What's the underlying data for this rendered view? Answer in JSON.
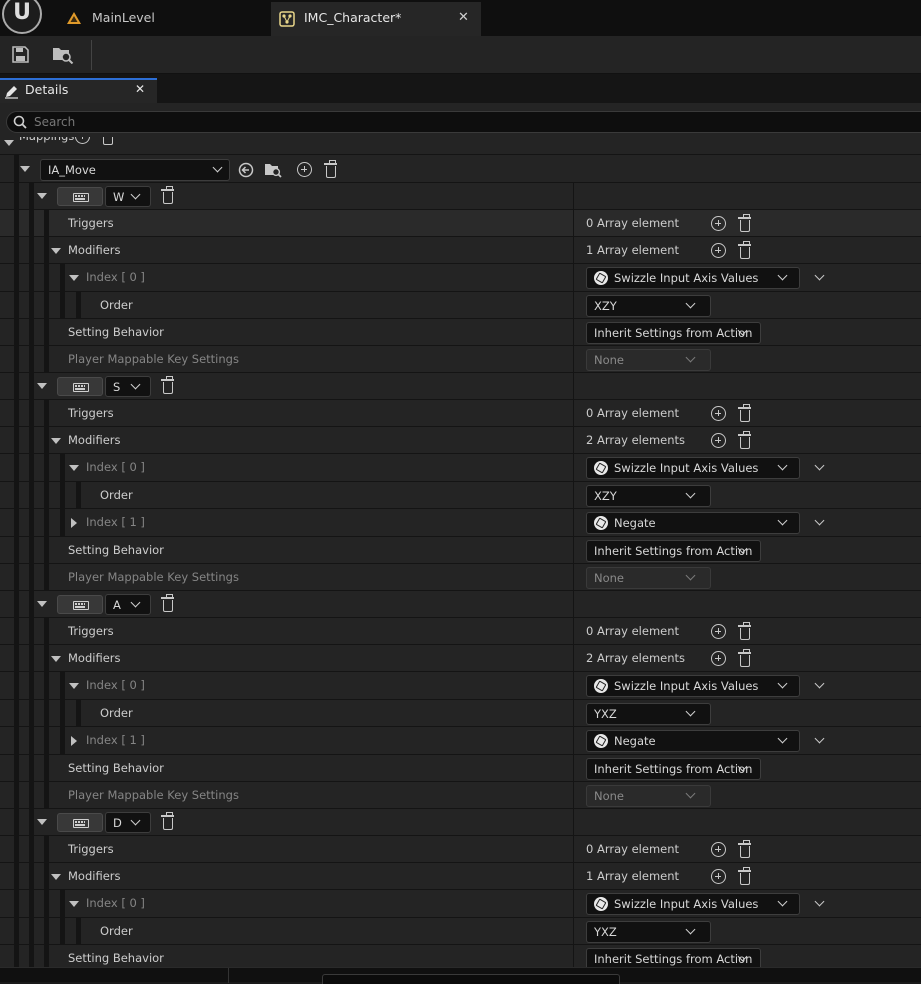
{
  "logo": "U",
  "tabs": [
    {
      "label": "MainLevel"
    },
    {
      "label": "IMC_Character*"
    }
  ],
  "panel": {
    "tab_label": "Details",
    "search_placeholder": "Search"
  },
  "mappings": {
    "label": "Mappings",
    "action": "IA_Move",
    "keys": [
      {
        "key": "W",
        "triggers": {
          "label": "Triggers",
          "value": "0 Array element"
        },
        "modifiers": {
          "label": "Modifiers",
          "value": "1 Array element"
        },
        "items": [
          {
            "index": "Index [ 0 ]",
            "expanded": true,
            "value": "Swizzle Input Axis Values",
            "order_label": "Order",
            "order": "XZY"
          }
        ],
        "setting": {
          "label": "Setting Behavior",
          "value": "Inherit Settings from Action"
        },
        "player": {
          "label": "Player Mappable Key Settings",
          "value": "None"
        }
      },
      {
        "key": "S",
        "triggers": {
          "label": "Triggers",
          "value": "0 Array element"
        },
        "modifiers": {
          "label": "Modifiers",
          "value": "2 Array elements"
        },
        "items": [
          {
            "index": "Index [ 0 ]",
            "expanded": true,
            "value": "Swizzle Input Axis Values",
            "order_label": "Order",
            "order": "XZY"
          },
          {
            "index": "Index [ 1 ]",
            "expanded": false,
            "value": "Negate"
          }
        ],
        "setting": {
          "label": "Setting Behavior",
          "value": "Inherit Settings from Action"
        },
        "player": {
          "label": "Player Mappable Key Settings",
          "value": "None"
        }
      },
      {
        "key": "A",
        "triggers": {
          "label": "Triggers",
          "value": "0 Array element"
        },
        "modifiers": {
          "label": "Modifiers",
          "value": "2 Array elements"
        },
        "items": [
          {
            "index": "Index [ 0 ]",
            "expanded": true,
            "value": "Swizzle Input Axis Values",
            "order_label": "Order",
            "order": "YXZ"
          },
          {
            "index": "Index [ 1 ]",
            "expanded": false,
            "value": "Negate"
          }
        ],
        "setting": {
          "label": "Setting Behavior",
          "value": "Inherit Settings from Action"
        },
        "player": {
          "label": "Player Mappable Key Settings",
          "value": "None"
        }
      },
      {
        "key": "D",
        "triggers": {
          "label": "Triggers",
          "value": "0 Array element"
        },
        "modifiers": {
          "label": "Modifiers",
          "value": "1 Array element"
        },
        "items": [
          {
            "index": "Index [ 0 ]",
            "expanded": true,
            "value": "Swizzle Input Axis Values",
            "order_label": "Order",
            "order": "YXZ"
          }
        ],
        "setting": {
          "label": "Setting Behavior",
          "value": "Inherit Settings from Action"
        }
      }
    ]
  }
}
